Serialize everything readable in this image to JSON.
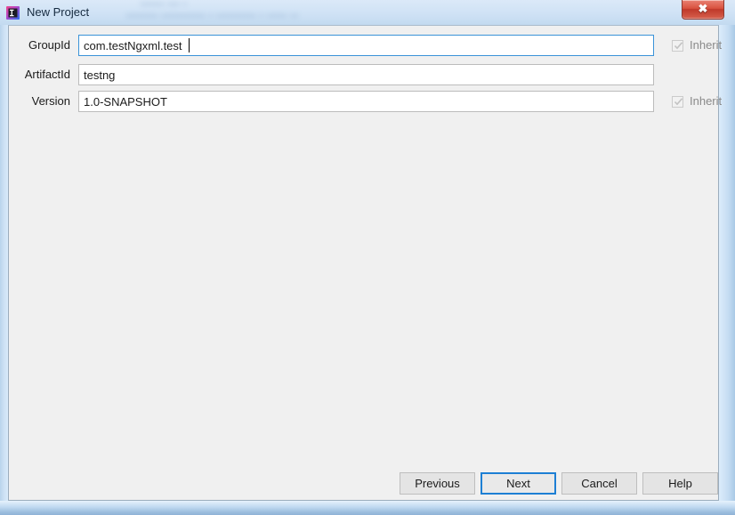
{
  "window": {
    "title": "New Project",
    "app_icon": "intellij-idea-icon",
    "close_label": "✖",
    "background_blur_line1": "••••••  ••• •",
    "background_blur_line2": "•••••••• ••••••••••• • •••••••••• • ••••• ••"
  },
  "form": {
    "rows": [
      {
        "label": "GroupId",
        "value": "com.testNgxml.test",
        "placeholder": "",
        "focused": true,
        "inherit": {
          "visible": true,
          "label": "Inherit",
          "checked": true,
          "enabled": false
        }
      },
      {
        "label": "ArtifactId",
        "value": "testng",
        "placeholder": "",
        "focused": false,
        "inherit": {
          "visible": false,
          "label": "",
          "checked": false,
          "enabled": false
        }
      },
      {
        "label": "Version",
        "value": "1.0-SNAPSHOT",
        "placeholder": "",
        "focused": false,
        "inherit": {
          "visible": true,
          "label": "Inherit",
          "checked": true,
          "enabled": false
        }
      }
    ]
  },
  "buttons": {
    "previous": "Previous",
    "next": "Next",
    "cancel": "Cancel",
    "help": "Help",
    "default_button": "Next"
  },
  "colors": {
    "focus_border": "#1d7fd4",
    "field_focus_border": "#3a93d8",
    "panel_background": "#f0f0f0",
    "frame_glass": "#cfe1f3",
    "close_button": "#c0392a",
    "disabled_text": "#8a8a8a"
  }
}
